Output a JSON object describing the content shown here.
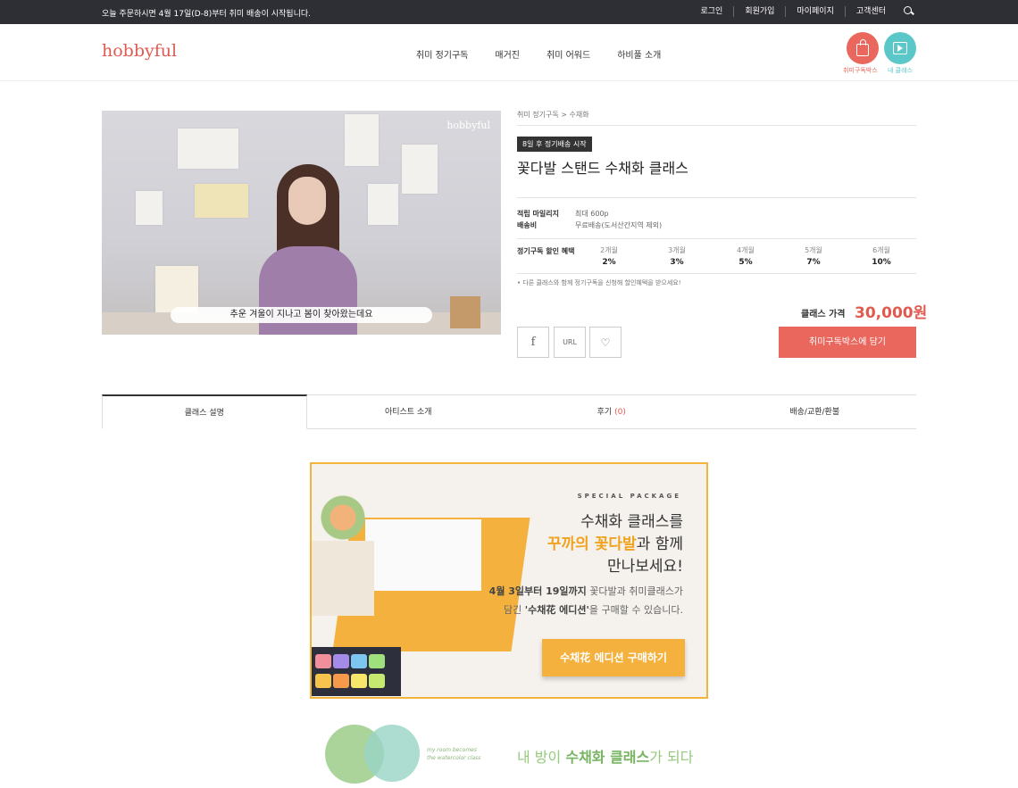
{
  "topbar": {
    "notice": "오늘 주문하시면 4월 17일(D-8)부터 취미 배송이 시작됩니다.",
    "links": [
      "로그인",
      "회원가입",
      "마이페이지",
      "고객센터"
    ],
    "search_icon": "search-icon"
  },
  "header": {
    "logo": "hobbyful",
    "nav": [
      "취미 정기구독",
      "매거진",
      "취미 어워드",
      "하비풀 소개"
    ],
    "box_label": "취미구독박스",
    "class_label": "내 클래스"
  },
  "video": {
    "watermark": "hobbyful",
    "subtitle": "추운 겨울이 지나고 봄이 찾아왔는데요"
  },
  "product": {
    "breadcrumb": "취미 정기구독 > 수채화",
    "badge": "8일 후 정기배송 시작",
    "title": "꽃다발 스탠드 수채화 클래스",
    "mileage_label": "적립 마일리지",
    "mileage_value": "최대 600p",
    "shipping_label": "배송비",
    "shipping_value": "무료배송(도서산간지역 제외)",
    "discount_label": "정기구독 할인 혜택",
    "discounts": [
      {
        "months": "2개월",
        "pct": "2%"
      },
      {
        "months": "3개월",
        "pct": "3%"
      },
      {
        "months": "4개월",
        "pct": "5%"
      },
      {
        "months": "5개월",
        "pct": "7%"
      },
      {
        "months": "6개월",
        "pct": "10%"
      }
    ],
    "note": "• 다른 클래스와 함께 정기구독을 신청해 할인혜택을 받으세요!",
    "price_label": "클래스 가격",
    "price": "30,000원",
    "fb": "f",
    "url": "URL",
    "heart": "♡",
    "cart": "취미구독박스에 담기"
  },
  "tabs": [
    {
      "label": "클래스 설명"
    },
    {
      "label": "아티스트 소개"
    },
    {
      "label": "후기 ",
      "count": "(0)"
    },
    {
      "label": "배송/교환/환불"
    }
  ],
  "banner": {
    "special": "SPECIAL PACKAGE",
    "line1": "수채화 클래스를",
    "line2_hl": "꾸까의 꽃다발",
    "line2_rest": "과 함께",
    "line3": "만나보세요!",
    "desc1_b": "4월 3일부터 19일까지",
    "desc1_rest": " 꽃다발과 취미클래스가",
    "desc2_pre": "담긴 ",
    "desc2_b": "'수채花 에디션'",
    "desc2_rest": "을 구매할 수 있습니다.",
    "button": "수채花 에디션 구매하기"
  },
  "bottom": {
    "small1": "my room becomes",
    "small2": "the watercolor class",
    "title_pre": "내 방이 ",
    "title_b": "수채화 클래스",
    "title_post": "가 되다"
  }
}
